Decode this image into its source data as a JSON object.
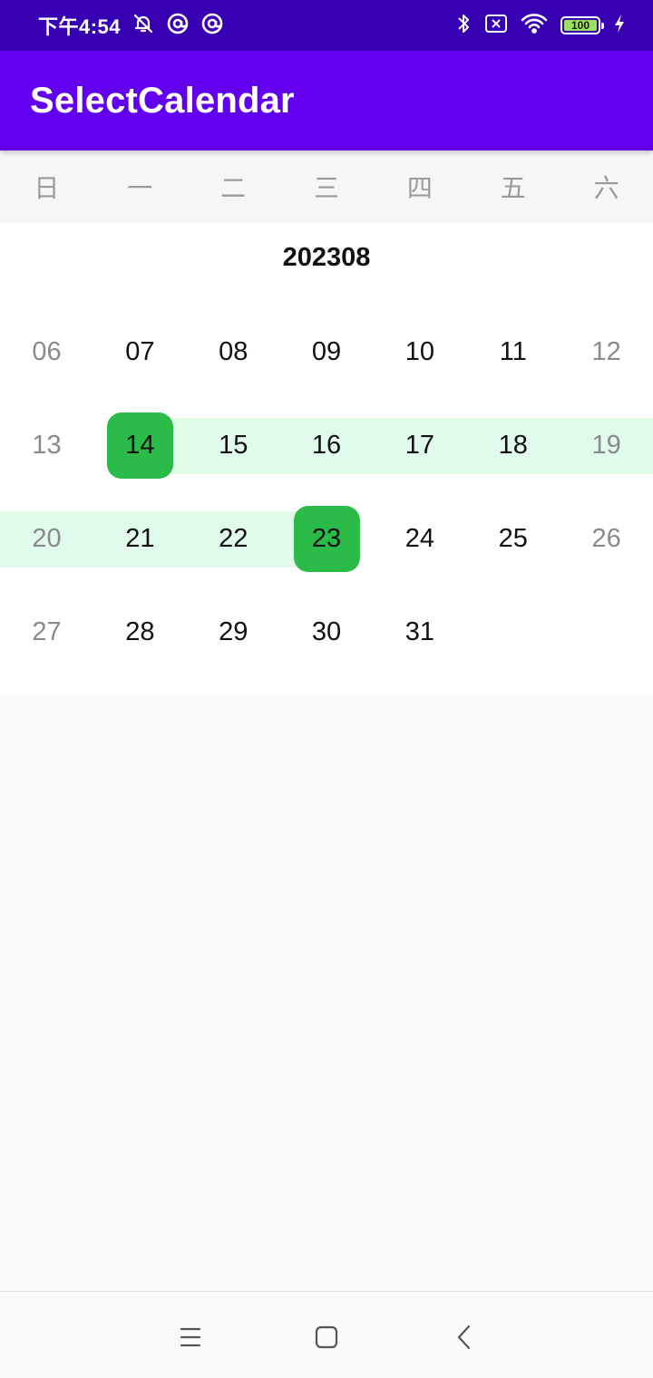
{
  "status_bar": {
    "time": "下午4:54",
    "battery": "100",
    "icons": [
      "mute-bell-icon",
      "at-icon",
      "at-icon",
      "bluetooth-icon",
      "no-sim-icon",
      "wifi-icon",
      "battery-icon",
      "charging-icon"
    ]
  },
  "app_bar": {
    "title": "SelectCalendar"
  },
  "weekdays": [
    "日",
    "一",
    "二",
    "三",
    "四",
    "五",
    "六"
  ],
  "calendar": {
    "month_label": "202308",
    "weeks": [
      [
        "06",
        "07",
        "08",
        "09",
        "10",
        "11",
        "12"
      ],
      [
        "13",
        "14",
        "15",
        "16",
        "17",
        "18",
        "19"
      ],
      [
        "20",
        "21",
        "22",
        "23",
        "24",
        "25",
        "26"
      ],
      [
        "27",
        "28",
        "29",
        "30",
        "31",
        "",
        ""
      ]
    ],
    "range_start": "14",
    "range_end": "23",
    "colors": {
      "selected": "#2bbb48",
      "in_range": "#e1fbeb",
      "weekend_text": "#8a8a8a",
      "weekday_text": "#111111"
    }
  },
  "nav_bar": {
    "icons": [
      "menu-icon",
      "home-icon",
      "back-icon"
    ]
  },
  "colors": {
    "status_bar": "#3700b3",
    "app_bar": "#6200ee"
  }
}
